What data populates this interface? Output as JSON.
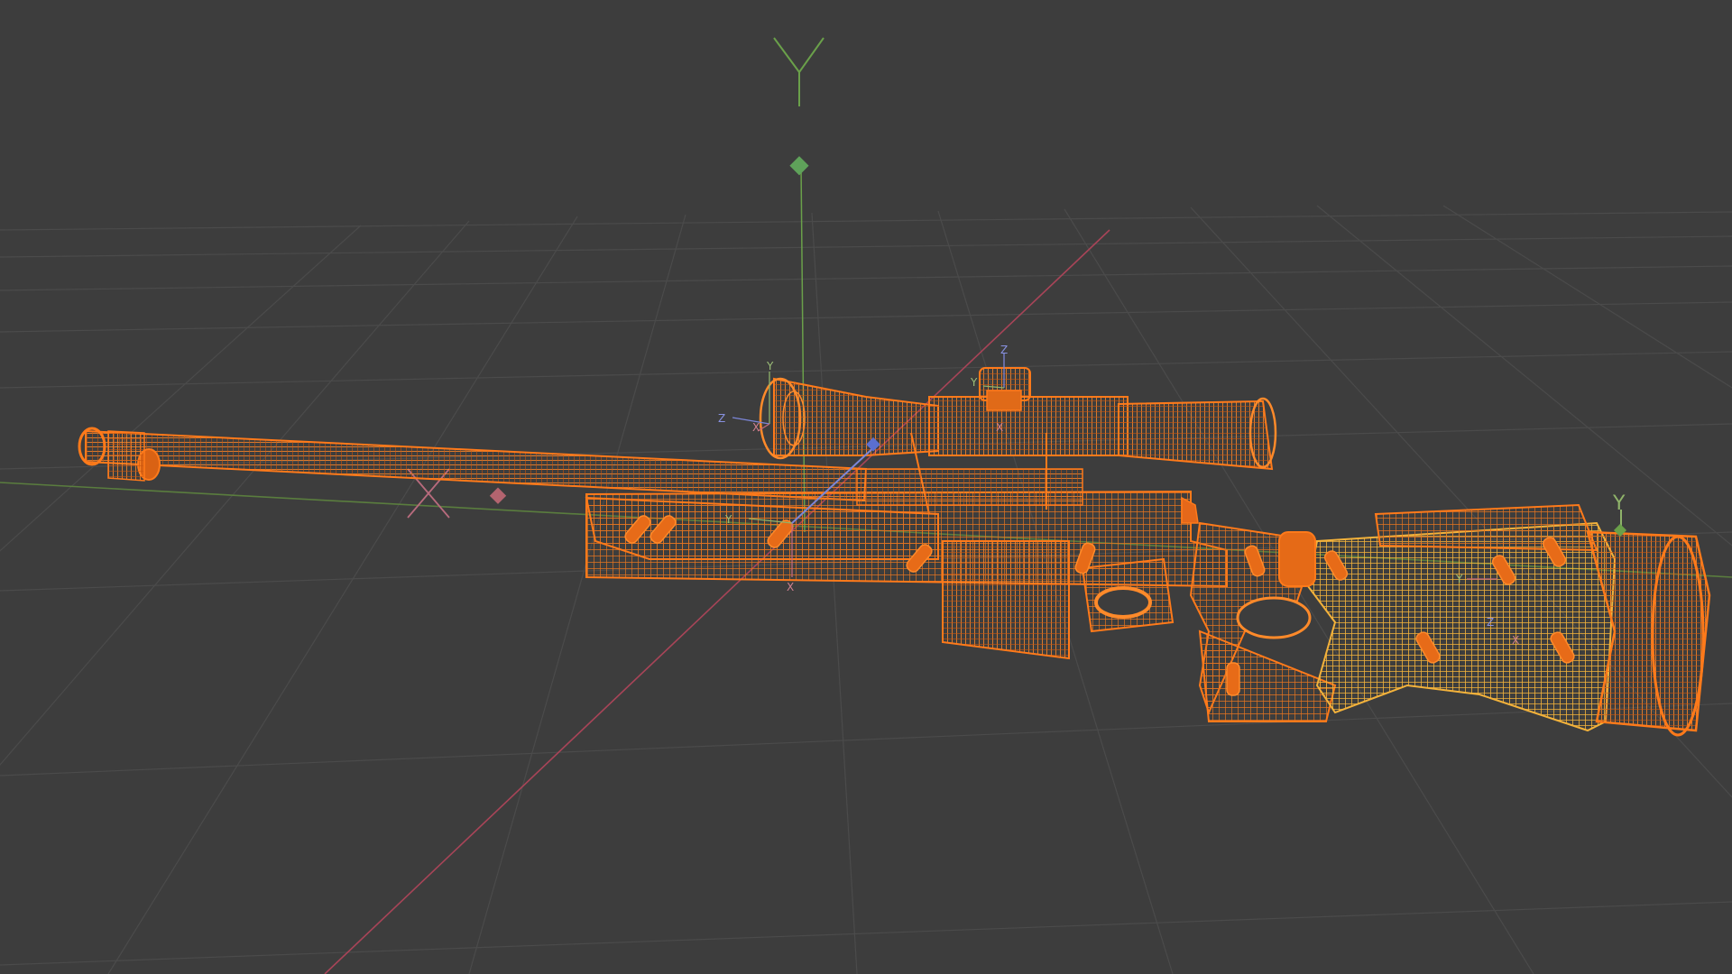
{
  "viewport": {
    "axis_labels": {
      "world_y": "Y",
      "world_x": "X",
      "scope_y": "Y",
      "scope_z": "Z",
      "scope_x": "X",
      "turret_z": "Z",
      "turret_y": "Y",
      "turret_x": "X",
      "chassis_y": "Y",
      "chassis_x": "X",
      "stock_y": "Y",
      "stock_x": "X",
      "stock_z": "Z",
      "butt_y": "Y"
    },
    "colors": {
      "background": "#3d3d3d",
      "grid": "#4a4a4a",
      "axis_x": "#c4445d",
      "axis_y": "#6a9b3f",
      "axis_z": "#5b6fd1",
      "wire_selected": "#e8691a",
      "wire_active": "#f2a22a",
      "empty_gizmo": "#d0d0d0"
    },
    "object": {
      "type": "rifle-wireframe",
      "selection": "selected"
    }
  }
}
